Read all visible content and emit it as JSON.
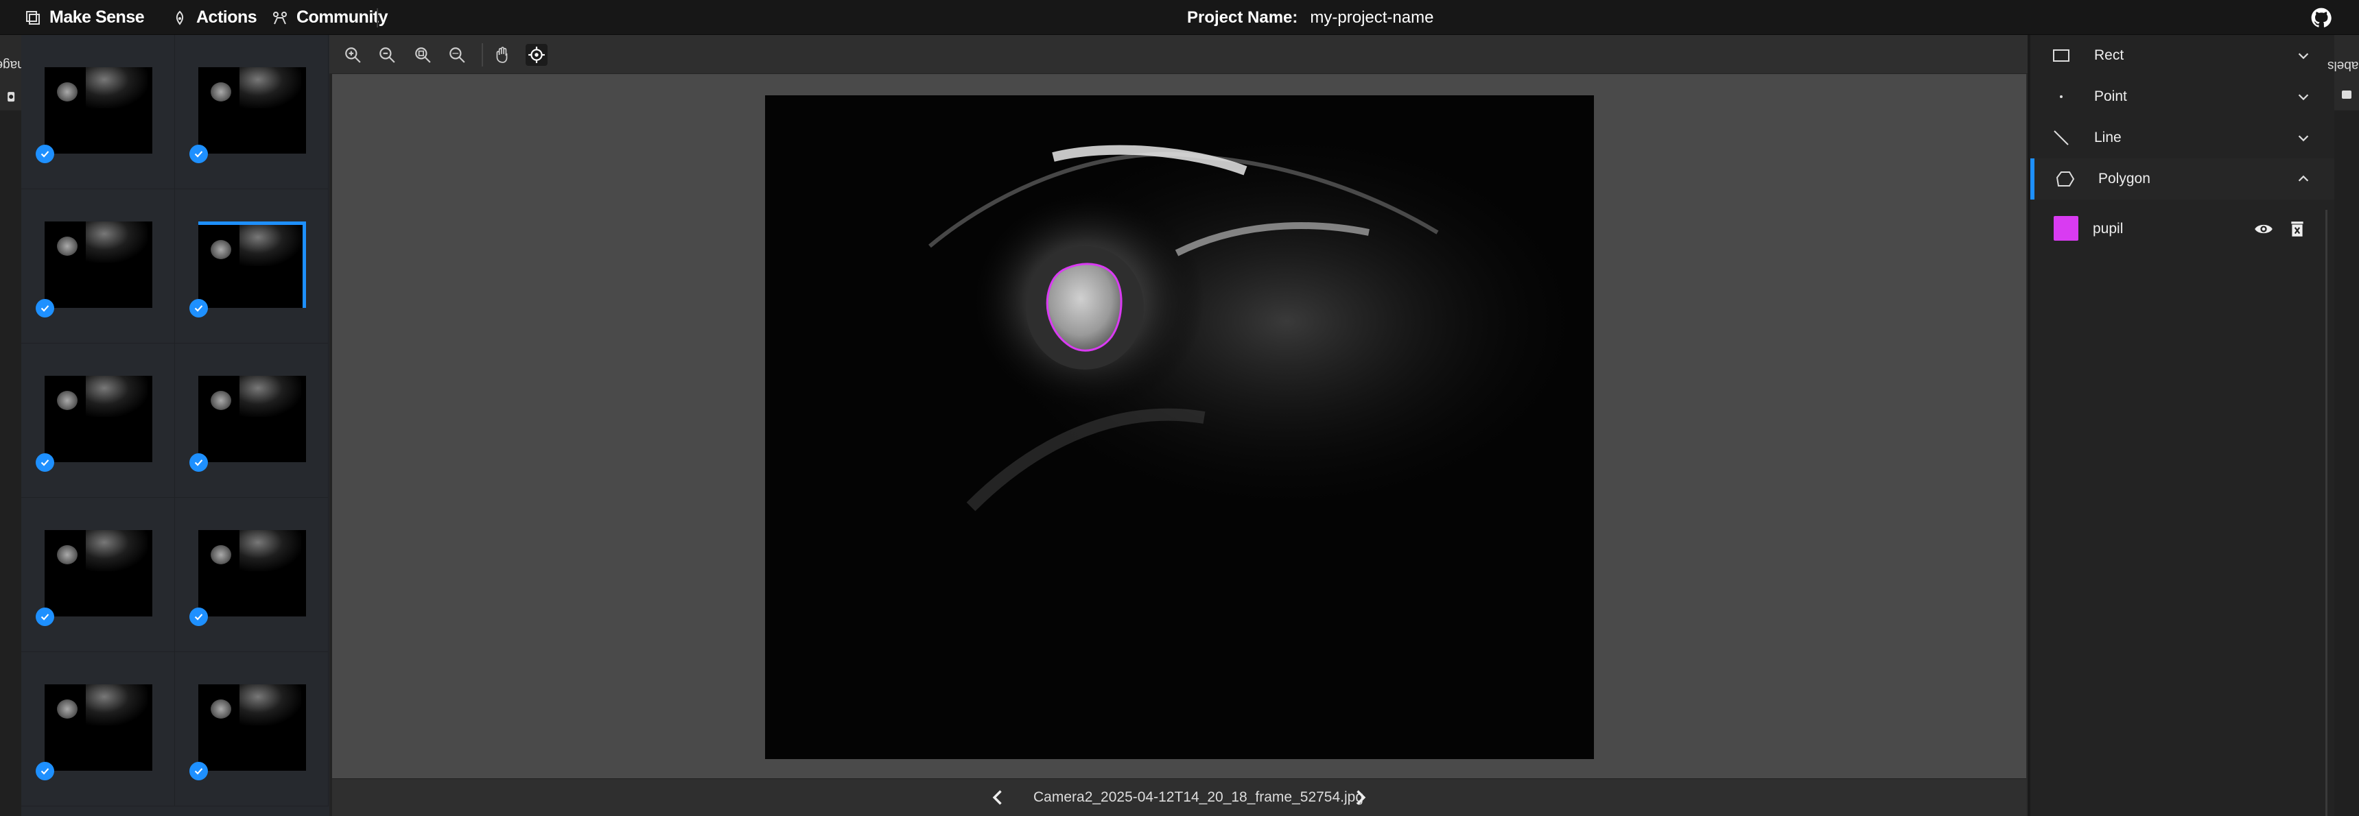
{
  "topbar": {
    "brand": "Make Sense",
    "actions": "Actions",
    "community": "Community",
    "project_label": "Project Name:",
    "project_name": "my-project-name",
    "github_icon": "github-icon"
  },
  "side_tabs": {
    "left": "Images",
    "right": "Labels"
  },
  "image_list": {
    "thumbnails": [
      {
        "checked": true,
        "selected": false
      },
      {
        "checked": true,
        "selected": false
      },
      {
        "checked": true,
        "selected": false
      },
      {
        "checked": true,
        "selected": true
      },
      {
        "checked": true,
        "selected": false
      },
      {
        "checked": true,
        "selected": false
      },
      {
        "checked": true,
        "selected": false
      },
      {
        "checked": true,
        "selected": false
      },
      {
        "checked": true,
        "selected": false
      },
      {
        "checked": true,
        "selected": false
      }
    ]
  },
  "toolbar": {
    "tools": [
      "zoom-in-icon",
      "zoom-out-icon",
      "zoom-fit-icon",
      "zoom-max-icon",
      "hand-icon",
      "crosshair-icon"
    ],
    "active_tool": "crosshair-icon"
  },
  "editor": {
    "file_name": "Camera2_2025-04-12T14_20_18_frame_52754.jpg"
  },
  "labels_panel": {
    "types": [
      {
        "label": "Rect",
        "icon": "rect-icon",
        "expanded": false
      },
      {
        "label": "Point",
        "icon": "point-icon",
        "expanded": false
      },
      {
        "label": "Line",
        "icon": "line-icon",
        "expanded": false
      },
      {
        "label": "Polygon",
        "icon": "polygon-icon",
        "expanded": true
      }
    ],
    "labels": [
      {
        "name": "pupil",
        "color": "#d93bf2"
      }
    ]
  },
  "colors": {
    "accent": "#1e90ff",
    "label_color": "#d93bf2"
  }
}
